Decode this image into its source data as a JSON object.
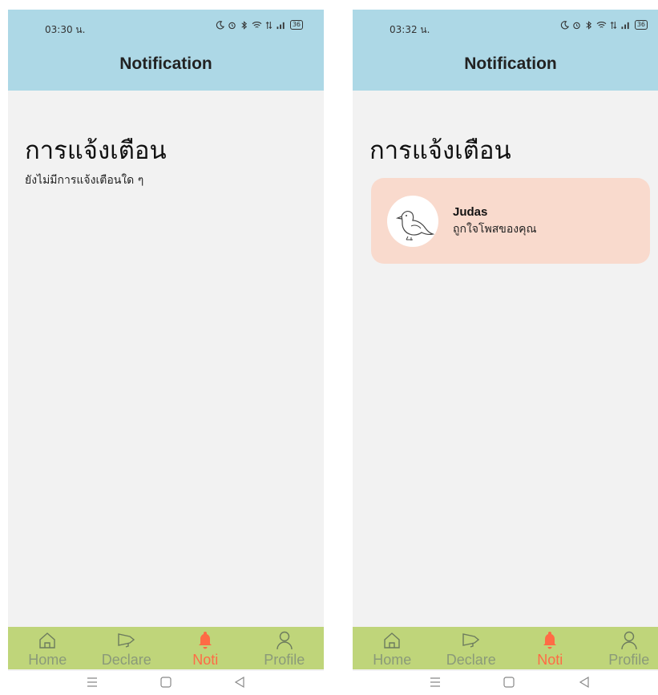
{
  "screens": [
    {
      "status": {
        "time": "03:30 น.",
        "battery": "36"
      },
      "header": {
        "title": "Notification"
      },
      "main": {
        "heading": "การแจ้งเตือน",
        "empty_message": "ยังไม่มีการแจ้งเตือนใด ๆ"
      },
      "nav": [
        {
          "label": "Home",
          "icon": "home-icon"
        },
        {
          "label": "Declare",
          "icon": "megaphone-icon"
        },
        {
          "label": "Noti",
          "icon": "bell-icon",
          "active": true
        },
        {
          "label": "Profile",
          "icon": "profile-icon"
        }
      ]
    },
    {
      "status": {
        "time": "03:32 น.",
        "battery": "36"
      },
      "header": {
        "title": "Notification"
      },
      "main": {
        "heading": "การแจ้งเตือน",
        "notifications": [
          {
            "name": "Judas",
            "message": "ถูกใจโพสของคุณ",
            "avatar": "dove-avatar"
          }
        ]
      },
      "nav": [
        {
          "label": "Home",
          "icon": "home-icon"
        },
        {
          "label": "Declare",
          "icon": "megaphone-icon"
        },
        {
          "label": "Noti",
          "icon": "bell-icon",
          "active": true
        },
        {
          "label": "Profile",
          "icon": "profile-icon"
        }
      ]
    }
  ],
  "colors": {
    "app_bar": "#add8e6",
    "background": "#f2f2f2",
    "bottom_nav": "#bfd57a",
    "active_tab": "#ff6b45",
    "inactive_tab": "#8a9a79",
    "notification_card": "#f9dacd"
  }
}
